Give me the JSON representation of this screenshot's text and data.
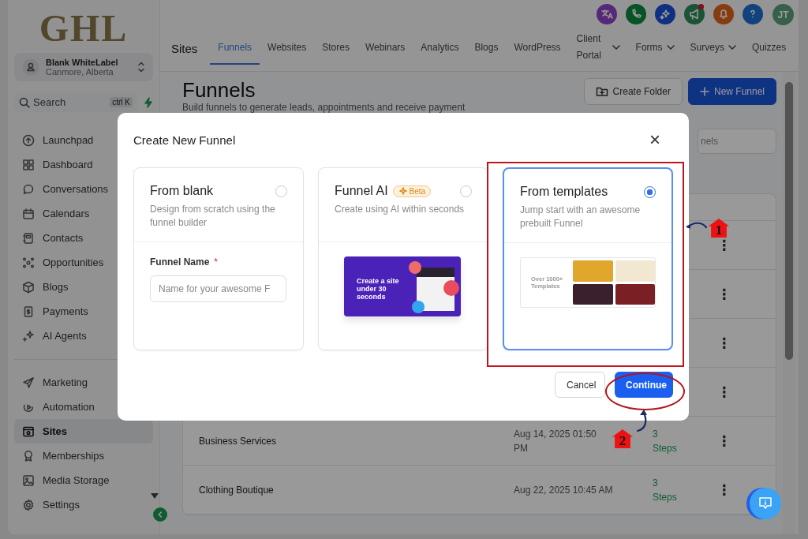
{
  "sidebar": {
    "logo": "GHL",
    "account": {
      "name": "Blank WhiteLabel",
      "location": "Canmore, Alberta"
    },
    "search": {
      "placeholder": "Search",
      "shortcut": "ctrl K"
    },
    "groups": [
      {
        "items": [
          {
            "label": "Launchpad",
            "selected": false
          },
          {
            "label": "Dashboard",
            "selected": false
          },
          {
            "label": "Conversations",
            "selected": false
          },
          {
            "label": "Calendars",
            "selected": false
          },
          {
            "label": "Contacts",
            "selected": false
          },
          {
            "label": "Opportunities",
            "selected": false
          },
          {
            "label": "Blogs",
            "selected": false
          },
          {
            "label": "Payments",
            "selected": false
          },
          {
            "label": "AI Agents",
            "selected": false
          }
        ]
      },
      {
        "items": [
          {
            "label": "Marketing",
            "selected": false
          },
          {
            "label": "Automation",
            "selected": false
          },
          {
            "label": "Sites",
            "selected": true
          },
          {
            "label": "Memberships",
            "selected": false
          },
          {
            "label": "Media Storage",
            "selected": false
          },
          {
            "label": "Settings",
            "selected": false
          }
        ]
      }
    ]
  },
  "header": {
    "avatar": "JT",
    "icons": [
      {
        "alert": false
      },
      {
        "alert": false
      },
      {
        "alert": false
      },
      {
        "alert": true
      },
      {
        "alert": false
      },
      {
        "alert": false
      }
    ]
  },
  "nav": {
    "title": "Sites",
    "tabs": [
      {
        "label": "Funnels",
        "selected": true,
        "dropdown": false
      },
      {
        "label": "Websites",
        "selected": false,
        "dropdown": false
      },
      {
        "label": "Stores",
        "selected": false,
        "dropdown": false
      },
      {
        "label": "Webinars",
        "selected": false,
        "dropdown": false
      },
      {
        "label": "Analytics",
        "selected": false,
        "dropdown": false
      },
      {
        "label": "Blogs",
        "selected": false,
        "dropdown": false
      },
      {
        "label": "WordPress",
        "selected": false,
        "dropdown": false
      },
      {
        "label": "Client Portal",
        "selected": false,
        "dropdown": true
      },
      {
        "label": "Forms",
        "selected": false,
        "dropdown": true
      },
      {
        "label": "Surveys",
        "selected": false,
        "dropdown": true
      },
      {
        "label": "Quizzes",
        "selected": false,
        "dropdown": false
      }
    ]
  },
  "page": {
    "title": "Funnels",
    "subtitle": "Build funnels to generate leads, appointments and receive payment",
    "buttons": [
      {
        "label": "Create Folder",
        "kind": "secondary"
      },
      {
        "label": "New Funnel",
        "kind": "primary"
      }
    ],
    "search": {
      "placeholder": "nels"
    }
  },
  "table": {
    "rows": [
      {
        "menu": "⋮"
      },
      {
        "menu": "⋮"
      },
      {
        "menu": "⋮"
      },
      {
        "menu": "⋮"
      },
      {
        "name": "Business Services",
        "date": "Aug 14, 2025 01:50 PM",
        "steps": "3 Steps",
        "menu": "⋮"
      },
      {
        "name": "Clothing Boutique",
        "date": "Aug 22, 2025 10:45 AM",
        "steps": "3 Steps",
        "menu": "⋮"
      }
    ]
  },
  "dialog": {
    "title": "Create New Funnel",
    "close": "×",
    "options": [
      {
        "kind": "blank",
        "title": "From blank",
        "description": "Design from scratch using the funnel builder",
        "selected": false,
        "field_label": "Funnel Name",
        "required": "*",
        "placeholder": "Name for your awesome F"
      },
      {
        "kind": "ai",
        "title": "Funnel AI",
        "badge": "Beta",
        "description": "Create using AI within seconds",
        "selected": false,
        "image_text": "Create a site under 30 seconds"
      },
      {
        "kind": "templates",
        "title": "From templates",
        "description": "Jump start with an awesome prebuilt Funnel",
        "selected": true,
        "image_text": "Over 1000+ Templates"
      }
    ],
    "buttons": [
      {
        "label": "Cancel",
        "kind": "secondary"
      },
      {
        "label": "Continue",
        "kind": "primary"
      }
    ]
  },
  "annotations": [
    {
      "label": "1"
    },
    {
      "label": "2"
    }
  ]
}
